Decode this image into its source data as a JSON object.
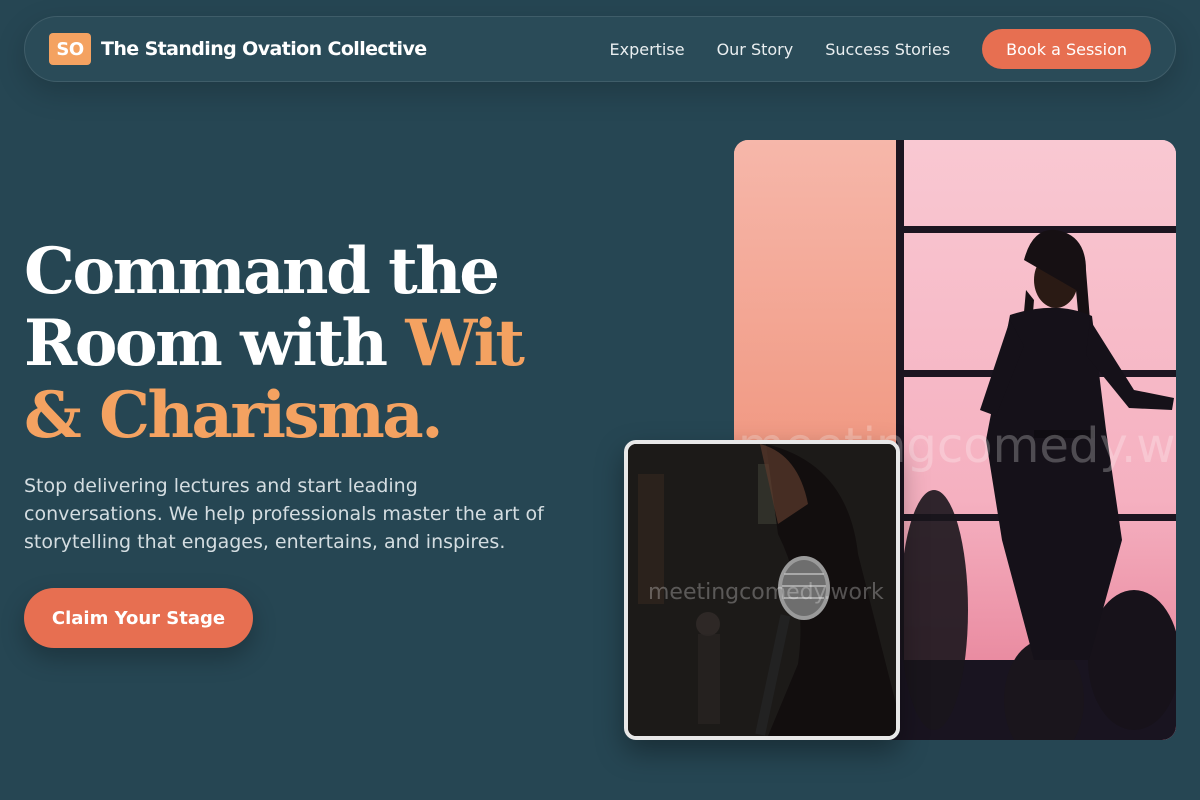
{
  "nav": {
    "logo_mark": "SO",
    "brand_name": "The Standing Ovation Collective",
    "links": [
      "Expertise",
      "Our Story",
      "Success Stories"
    ],
    "cta_label": "Book a Session"
  },
  "hero": {
    "headline_part1": "Command the Room with ",
    "headline_accent": "Wit & Charisma.",
    "subtext": "Stop delivering lectures and start leading conversations. We help professionals master the art of storytelling that engages, entertains, and inspires.",
    "cta_label": "Claim Your Stage"
  },
  "images": {
    "main_photo_icon": "speaker-on-stage-photo",
    "small_photo_icon": "microphone-photo",
    "main_watermark": "meetingcomedy.work",
    "small_watermark": "meetingcomedy.work"
  },
  "colors": {
    "background": "#264653",
    "accent_orange": "#f4a261",
    "cta_coral": "#e76f51"
  }
}
